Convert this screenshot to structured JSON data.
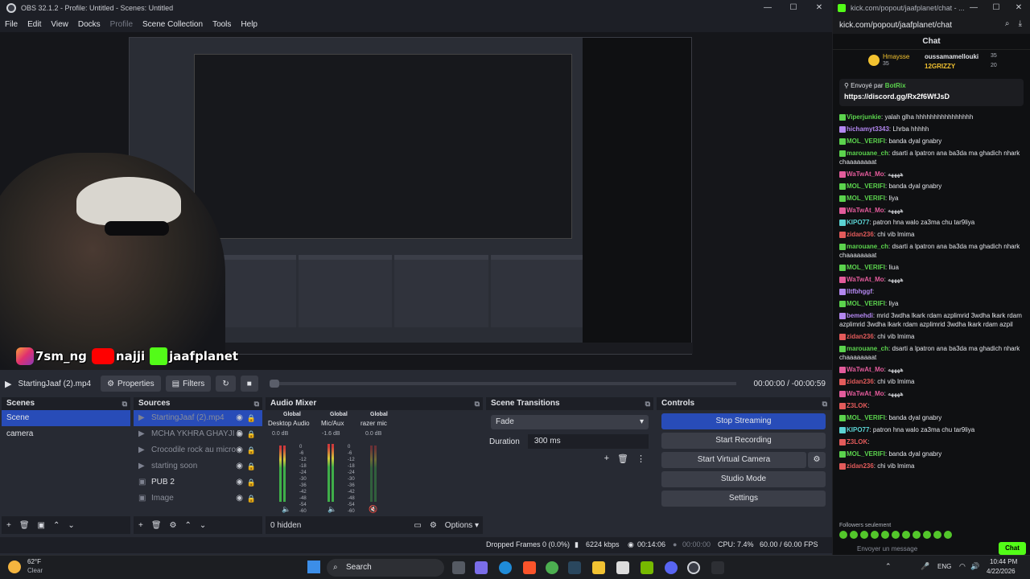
{
  "obs": {
    "title": "OBS 32.1.2 - Profile: Untitled - Scenes: Untitled",
    "window_controls": [
      "—",
      "☐",
      "✕"
    ],
    "menu": [
      "File",
      "Edit",
      "View",
      "Docks",
      "Profile",
      "Scene Collection",
      "Tools",
      "Help"
    ],
    "overlay_banner": {
      "ig": "7sm_ng",
      "yt": "najji",
      "kick": "jaafplanet"
    },
    "media": {
      "name": "StartingJaaf (2).mp4",
      "properties": "Properties",
      "filters": "Filters",
      "time": "00:00:00  /  -00:00:59"
    },
    "scenes": {
      "title": "Scenes",
      "items": [
        "Scene",
        "camera"
      ]
    },
    "sources": {
      "title": "Sources",
      "items": [
        "StartingJaaf (2).mp4",
        "MCHA YKHRA GHAYJI D",
        "Crocodile rock au micro",
        "starting soon",
        "PUB 2",
        "Image"
      ]
    },
    "mixer": {
      "title": "Audio Mixer",
      "channels": [
        {
          "global": "Global",
          "name": "Desktop Audio",
          "db": "0.0 dB"
        },
        {
          "global": "Global",
          "name": "Mic/Aux",
          "db": "-1.6 dB"
        },
        {
          "global": "Global",
          "name": "razer mic",
          "db": "0.0 dB"
        }
      ],
      "scale": [
        "0",
        "-6",
        "-12",
        "-18",
        "-24",
        "-30",
        "-36",
        "-42",
        "-48",
        "-54",
        "-60"
      ],
      "hidden": "0 hidden",
      "options": "Options"
    },
    "transitions": {
      "title": "Scene Transitions",
      "type": "Fade",
      "duration_label": "Duration",
      "duration": "300 ms"
    },
    "controls": {
      "title": "Controls",
      "buttons": [
        "Stop Streaming",
        "Start Recording",
        "Start Virtual Camera",
        "Studio Mode",
        "Settings"
      ]
    },
    "status": {
      "dropped": "Dropped Frames 0 (0.0%)",
      "kbps": "6224 kbps",
      "stream_time": "00:14:06",
      "rec_time": "00:00:00",
      "cpu": "CPU: 7.4%",
      "fps": "60.00 / 60.00 FPS"
    }
  },
  "chat": {
    "window_title": "kick.com/popout/jaafplanet/chat - ...",
    "url": "kick.com/popout/jaafplanet/chat",
    "header": "Chat",
    "top": [
      {
        "name": "Hmaysse",
        "count": "35"
      },
      {
        "name": "oussamamellouki",
        "count": "35"
      },
      {
        "name": "12GRIZZY",
        "count": "20"
      }
    ],
    "pinned": {
      "by_label": "Envoyé par",
      "by": "BotRix",
      "link": "https://discord.gg/Rx2f6WfJsD"
    },
    "messages": [
      {
        "user": "Viperjunkie",
        "color": "#5bd34d",
        "text": "yalah glha hhhhhhhhhhhhhhhh"
      },
      {
        "user": "hichamyt3343",
        "color": "#b387f0",
        "text": "Lhrba hhhhh"
      },
      {
        "user": "MOL_VERIFI",
        "color": "#5bd34d",
        "text": "banda dyal gnabry"
      },
      {
        "user": "marouane_ch",
        "color": "#5bd34d",
        "text": "dsarti a lpatron ana ba3da ma ghadich nhark chaaaaaaaat"
      },
      {
        "user": "WaTwAt_Mo",
        "color": "#e35b9b",
        "text": "ههههه"
      },
      {
        "user": "MOL_VERIFI",
        "color": "#5bd34d",
        "text": "banda dyal gnabry"
      },
      {
        "user": "MOL_VERIFI",
        "color": "#5bd34d",
        "text": "liya"
      },
      {
        "user": "WaTwAt_Mo",
        "color": "#e35b9b",
        "text": "ههههه"
      },
      {
        "user": "KIPO77",
        "color": "#5bd3d3",
        "text": "patron hna walo za3ma chu tar9liya"
      },
      {
        "user": "zidan236",
        "color": "#e35b5b",
        "text": "chi vib lmima"
      },
      {
        "user": "marouane_ch",
        "color": "#5bd34d",
        "text": "dsarti a lpatron ana ba3da ma ghadich nhark chaaaaaaaat"
      },
      {
        "user": "MOL_VERIFI",
        "color": "#5bd34d",
        "text": "liua"
      },
      {
        "user": "WaTwAt_Mo",
        "color": "#e35b9b",
        "text": "ههههه"
      },
      {
        "user": "lltfbhggf",
        "color": "#b387f0",
        "text": ""
      },
      {
        "user": "MOL_VERIFI",
        "color": "#5bd34d",
        "text": "liya"
      },
      {
        "user": "bemehdi",
        "color": "#b387f0",
        "text": "mrid 3wdha lkark rdam azplimrid 3wdha lkark rdam azplimrid 3wdha lkark rdam azplimrid 3wdha lkark rdam azpil"
      },
      {
        "user": "zidan236",
        "color": "#e35b5b",
        "text": "chi vib lmima"
      },
      {
        "user": "marouane_ch",
        "color": "#5bd34d",
        "text": "dsarti a lpatron ana ba3da ma ghadich nhark chaaaaaaaat"
      },
      {
        "user": "WaTwAt_Mo",
        "color": "#e35b9b",
        "text": "ههههه"
      },
      {
        "user": "zidan236",
        "color": "#e35b5b",
        "text": "chi vib lmima"
      },
      {
        "user": "WaTwAt_Mo",
        "color": "#e35b9b",
        "text": "ههههه"
      },
      {
        "user": "Z3LOK",
        "color": "#e35b5b",
        "text": ""
      },
      {
        "user": "MOL_VERIFI",
        "color": "#5bd34d",
        "text": "banda dyal gnabry"
      },
      {
        "user": "KIPO77",
        "color": "#5bd3d3",
        "text": "patron hna walo za3ma chu tar9liya"
      },
      {
        "user": "Z3LOK",
        "color": "#e35b5b",
        "text": ""
      },
      {
        "user": "MOL_VERIFI",
        "color": "#5bd34d",
        "text": "banda dyal gnabry"
      },
      {
        "user": "zidan236",
        "color": "#e35b5b",
        "text": "chi vib lmima"
      }
    ],
    "followers_only": "Followers seulement",
    "placeholder": "Envoyer un message",
    "send": "Chat"
  },
  "taskbar": {
    "weather_temp": "62°F",
    "weather_desc": "Clear",
    "search": "Search",
    "lang": "ENG",
    "time": "10:44 PM",
    "date": "4/22/2026"
  },
  "colors": {
    "accent": "#284cb8",
    "kick": "#53fc18",
    "bg": "#272a33"
  }
}
